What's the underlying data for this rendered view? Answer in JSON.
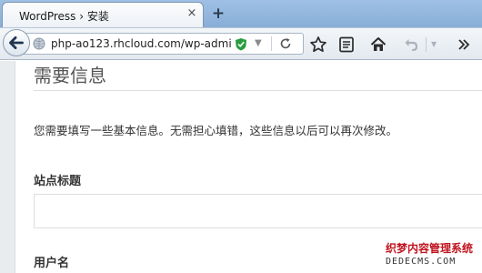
{
  "tab": {
    "title": "WordPress › 安装",
    "close": "×",
    "new_tab": "+"
  },
  "address_bar": {
    "url": "php-ao123.rhcloud.com/wp-admi"
  },
  "page": {
    "heading": "需要信息",
    "intro": "您需要填写一些基本信息。无需担心填错，这些信息以后可以再次修改。",
    "site_title_label": "站点标题",
    "site_title_value": "",
    "username_label": "用户名"
  },
  "watermark": {
    "brand": "织梦内容管理系统",
    "domain": "DEDECMS.COM"
  },
  "colors": {
    "accent_green": "#2a9d3f",
    "tab_strip": "#9fc0e4",
    "heading": "#555555",
    "watermark_red": "#c0141e"
  },
  "icons": [
    "back-arrow-icon",
    "globe-icon",
    "shield-check-icon",
    "reload-icon",
    "bookmark-star-icon",
    "reading-list-icon",
    "home-icon",
    "undo-icon",
    "overflow-chevron-icon"
  ]
}
